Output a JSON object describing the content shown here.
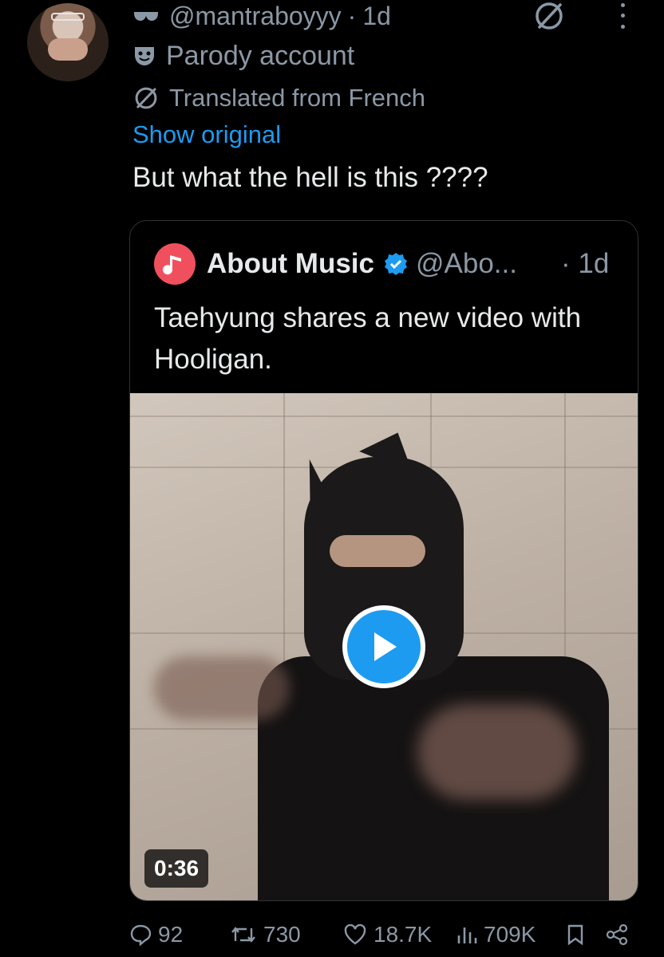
{
  "tweet": {
    "handle": "@mantraboyyy",
    "separator": "·",
    "time": "1d",
    "handle_icon": "sunglasses-icon",
    "label": "Parody account",
    "label_icon": "parody-mask-icon",
    "translation_note": "Translated from French",
    "show_original": "Show original",
    "text": "But what the hell is this ????"
  },
  "quote": {
    "name": "About Music",
    "handle": "@Abo...",
    "time": "· 1d",
    "text": "Taehyung shares a new video with Hooligan.",
    "video_duration": "0:36"
  },
  "actions": {
    "replies": "92",
    "reposts": "730",
    "likes": "18.7K",
    "views": "709K"
  },
  "colors": {
    "background": "#000000",
    "text": "#e7e9ea",
    "muted": "#8b98a5",
    "link": "#1d9bf0",
    "verified": "#1d9bf0",
    "quote_avatar": "#f0505e"
  }
}
